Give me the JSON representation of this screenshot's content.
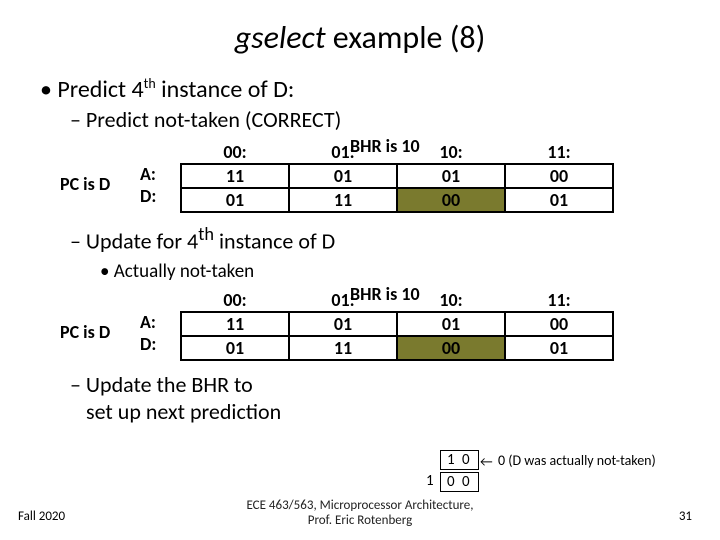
{
  "title_ital": "gselect",
  "title_rest": " example (8)",
  "bullet1_pre": "• Predict 4",
  "bullet1_sup": "th",
  "bullet1_post": " instance of D:",
  "bullet1a": "– Predict not-taken (CORRECT)",
  "pc_label": "PC is D",
  "ad_a": "A:",
  "ad_d": "D:",
  "bhr_label": "BHR is 10",
  "cols": {
    "c0": "00:",
    "c1": "01:",
    "c2": "10:",
    "c3": "11:"
  },
  "rowA": {
    "c0": "11",
    "c1": "01",
    "c2": "01",
    "c3": "00"
  },
  "rowD": {
    "c0": "01",
    "c1": "11",
    "c2": "00",
    "c3": "01"
  },
  "bullet2_pre": "– Update for 4",
  "bullet2_sup": "th",
  "bullet2_post": " instance of D",
  "bullet2a": "• Actually not-taken",
  "bullet3a": "– Update the BHR to",
  "bullet3b": "set up next prediction",
  "bhr_old": "1 0",
  "bhr_new": "0 0",
  "bhr_shift": "1",
  "bhr_arrow": "←",
  "bhr_note": "0 (D was actually not-taken)",
  "footer_center1": "ECE 463/563, Microprocessor Architecture,",
  "footer_center2": "Prof. Eric Rotenberg",
  "footer_left": "Fall 2020",
  "footer_right": "31"
}
